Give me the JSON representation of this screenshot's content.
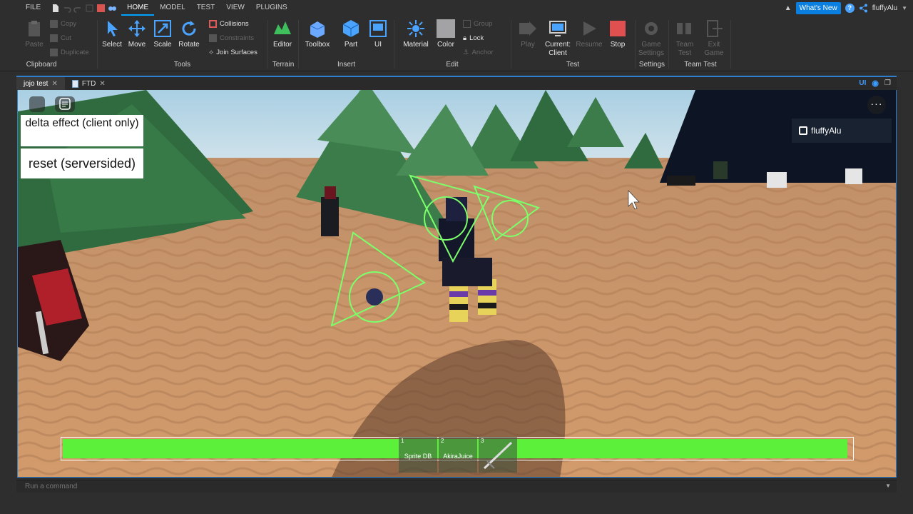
{
  "menu": {
    "file": "FILE",
    "tabs": [
      "HOME",
      "MODEL",
      "TEST",
      "VIEW",
      "PLUGINS"
    ],
    "whats_new": "What's New",
    "username": "fluffyAlu"
  },
  "ribbon": {
    "clipboard": {
      "paste": "Paste",
      "copy": "Copy",
      "cut": "Cut",
      "duplicate": "Duplicate",
      "label": "Clipboard"
    },
    "tools": {
      "select": "Select",
      "move": "Move",
      "scale": "Scale",
      "rotate": "Rotate",
      "collisions": "Collisions",
      "constraints": "Constraints",
      "join_surfaces": "Join Surfaces",
      "label": "Tools"
    },
    "terrain": {
      "editor": "Editor",
      "label": "Terrain"
    },
    "insert": {
      "toolbox": "Toolbox",
      "part": "Part",
      "ui": "UI",
      "label": "Insert"
    },
    "edit": {
      "material": "Material",
      "color": "Color",
      "group": "Group",
      "lock": "Lock",
      "anchor": "Anchor",
      "label": "Edit"
    },
    "test": {
      "play": "Play",
      "current_line1": "Current:",
      "current_line2": "Client",
      "resume": "Resume",
      "stop": "Stop",
      "label": "Test"
    },
    "settings": {
      "game_line1": "Game",
      "game_line2": "Settings",
      "label": "Settings"
    },
    "team_test": {
      "team_line1": "Team",
      "team_line2": "Test",
      "exit_line1": "Exit",
      "exit_line2": "Game",
      "label": "Team Test"
    }
  },
  "doc_tabs": [
    {
      "label": "jojo test"
    },
    {
      "label": "FTD"
    }
  ],
  "viewport": {
    "ui_toggle": "UI",
    "gui_button_1": "delta effect (client only)",
    "gui_button_2": "reset (serversided)",
    "player_name": "fluffyAlu",
    "more": "···",
    "health_fraction": 0.995,
    "hotbar": [
      {
        "num": "1",
        "name": "Sprite DB"
      },
      {
        "num": "2",
        "name": "AkiraJuice"
      },
      {
        "num": "3",
        "name": ""
      }
    ]
  },
  "command_bar": {
    "placeholder": "Run a command"
  },
  "colors": {
    "accent": "#00a2ff",
    "health": "#5cf03a",
    "sand": "#c79468",
    "sky": "#b8d8e8"
  }
}
